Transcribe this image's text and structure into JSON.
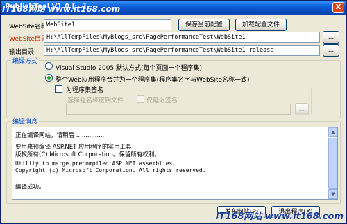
{
  "window": {
    "title": "PublishTool V1.0 [...]",
    "close_glyph": "X",
    "watermark_top": "IT168网站 www.it168.com",
    "watermark_bottom": "IT168网站 www.it168.com"
  },
  "fields": {
    "website_name_label": "WebSite名称",
    "website_name_value": "WebSite1",
    "website_dir_label": "WebSite目录",
    "website_dir_value": "H:\\AllTempFiles\\MyBlogs_src\\PagePerformanceTest\\WebSite1",
    "output_dir_label": "输出目录",
    "output_dir_value": "H:\\AllTempFiles\\MyBlogs_src\\PagePerformanceTest\\WebSite1_release",
    "browse_label": "..."
  },
  "toolbar": {
    "save_config_label": "保存当前配置",
    "load_config_label": "加载配置文件"
  },
  "compile_mode": {
    "group_title": "编译方式",
    "option_default": "Visual Studio 2005 默认方式(每个页面一个程序集)",
    "option_merge": "整个Web应用程序合并为一个程序集(程序集名字与WebSite名称一致)",
    "selected": "option_merge",
    "sign_label": "为程序集签名",
    "sign_checked": false,
    "keyfile_label": "选择强名称密钥文件",
    "delay_sign_label": "仅延迟签名",
    "keyfile_value": "",
    "keyfile_browse_label": "..."
  },
  "log": {
    "group_title": "编译消息",
    "lines": [
      "正在编译网站，请稍后 ...............",
      "要用来预编译 ASP.NET 应用程序的实用工具",
      "版权所有(C) Microsoft Corporation。保留所有权利。",
      "Utility to merge precompiled ASP.NET assemblies.",
      "Copyright (c) Microsoft Corporation. All rights reserved.",
      "编译成功。"
    ]
  },
  "actions": {
    "publish_label": "发布网站(P)",
    "exit_label": "退出程序(X)"
  },
  "colors": {
    "accent": "#0046d5",
    "label_red": "#d81e06",
    "window_bg": "#ece9d8",
    "titlebar": "#0a5fd8"
  }
}
